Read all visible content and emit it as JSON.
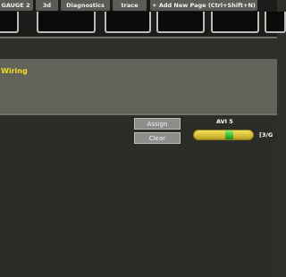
{
  "tabs": [
    {
      "label": "GAUGE 2"
    },
    {
      "label": "3d"
    },
    {
      "label": "Diagnostics"
    },
    {
      "label": "trace"
    },
    {
      "label": "+ Add New Page (Ctrl+Shift+N)"
    }
  ],
  "wiring": {
    "title": "Wiring"
  },
  "actions": {
    "assign_label": "Assign",
    "clear_label": "Clear"
  },
  "channel": {
    "name": "AVI 5",
    "value_text": "[3/G",
    "level": 0.6
  },
  "colors": {
    "title_yellow": "#f2df24",
    "bar_yellow": "#d8c13a",
    "bar_green": "#3fbf33"
  }
}
